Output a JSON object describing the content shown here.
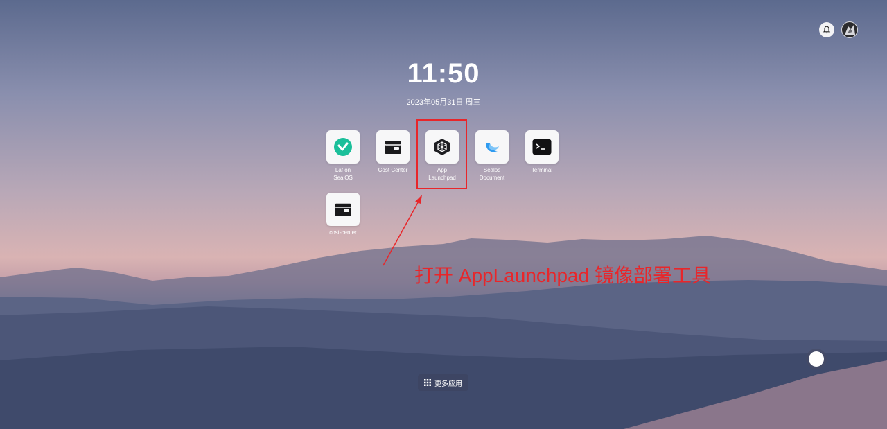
{
  "clock": {
    "time": "11:50",
    "date": "2023年05月31日 周三"
  },
  "apps": [
    {
      "label": "Laf on\nSealOS",
      "icon": "laf-logo-icon"
    },
    {
      "label": "Cost Center",
      "icon": "wallet-icon"
    },
    {
      "label": "App\nLaunchpad",
      "icon": "hexagon-cube-icon"
    },
    {
      "label": "Sealos\nDocument",
      "icon": "sealos-wave-icon"
    },
    {
      "label": "Terminal",
      "icon": "terminal-icon"
    },
    {
      "label": "cost-center",
      "icon": "wallet-icon"
    }
  ],
  "annotation": {
    "text": "打开 AppLaunchpad 镜像部署工具",
    "color": "#e8262a"
  },
  "dock": {
    "more_apps_label": "更多应用"
  },
  "colors": {
    "accent_red": "#e8262a",
    "laf_green": "#1bbf9a",
    "sealos_blue": "#2f9bf0"
  }
}
